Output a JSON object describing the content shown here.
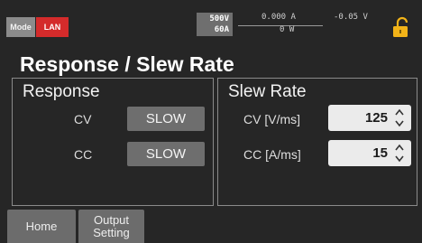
{
  "status_bar": {
    "mode_label": "Mode",
    "lan_label": "LAN",
    "range_voltage": "500V",
    "range_current": "60A",
    "measured_current": "0.000 A",
    "measured_voltage": "-0.05 V",
    "measured_power": "0 W",
    "lock_icon": "lock-icon",
    "lock_color": "#f2b318",
    "lan_color": "#d42b2b"
  },
  "page": {
    "title": "Response / Slew Rate"
  },
  "response": {
    "title": "Response",
    "cv_label": "CV",
    "cv_value": "SLOW",
    "cc_label": "CC",
    "cc_value": "SLOW"
  },
  "slew_rate": {
    "title": "Slew Rate",
    "cv_label": "CV [V/ms]",
    "cv_value": "125",
    "cc_label": "CC [A/ms]",
    "cc_value": "15",
    "spinner_icon": "up-down-arrows-icon"
  },
  "tabs": {
    "home": "Home",
    "output_line1": "Output",
    "output_line2": "Setting"
  }
}
